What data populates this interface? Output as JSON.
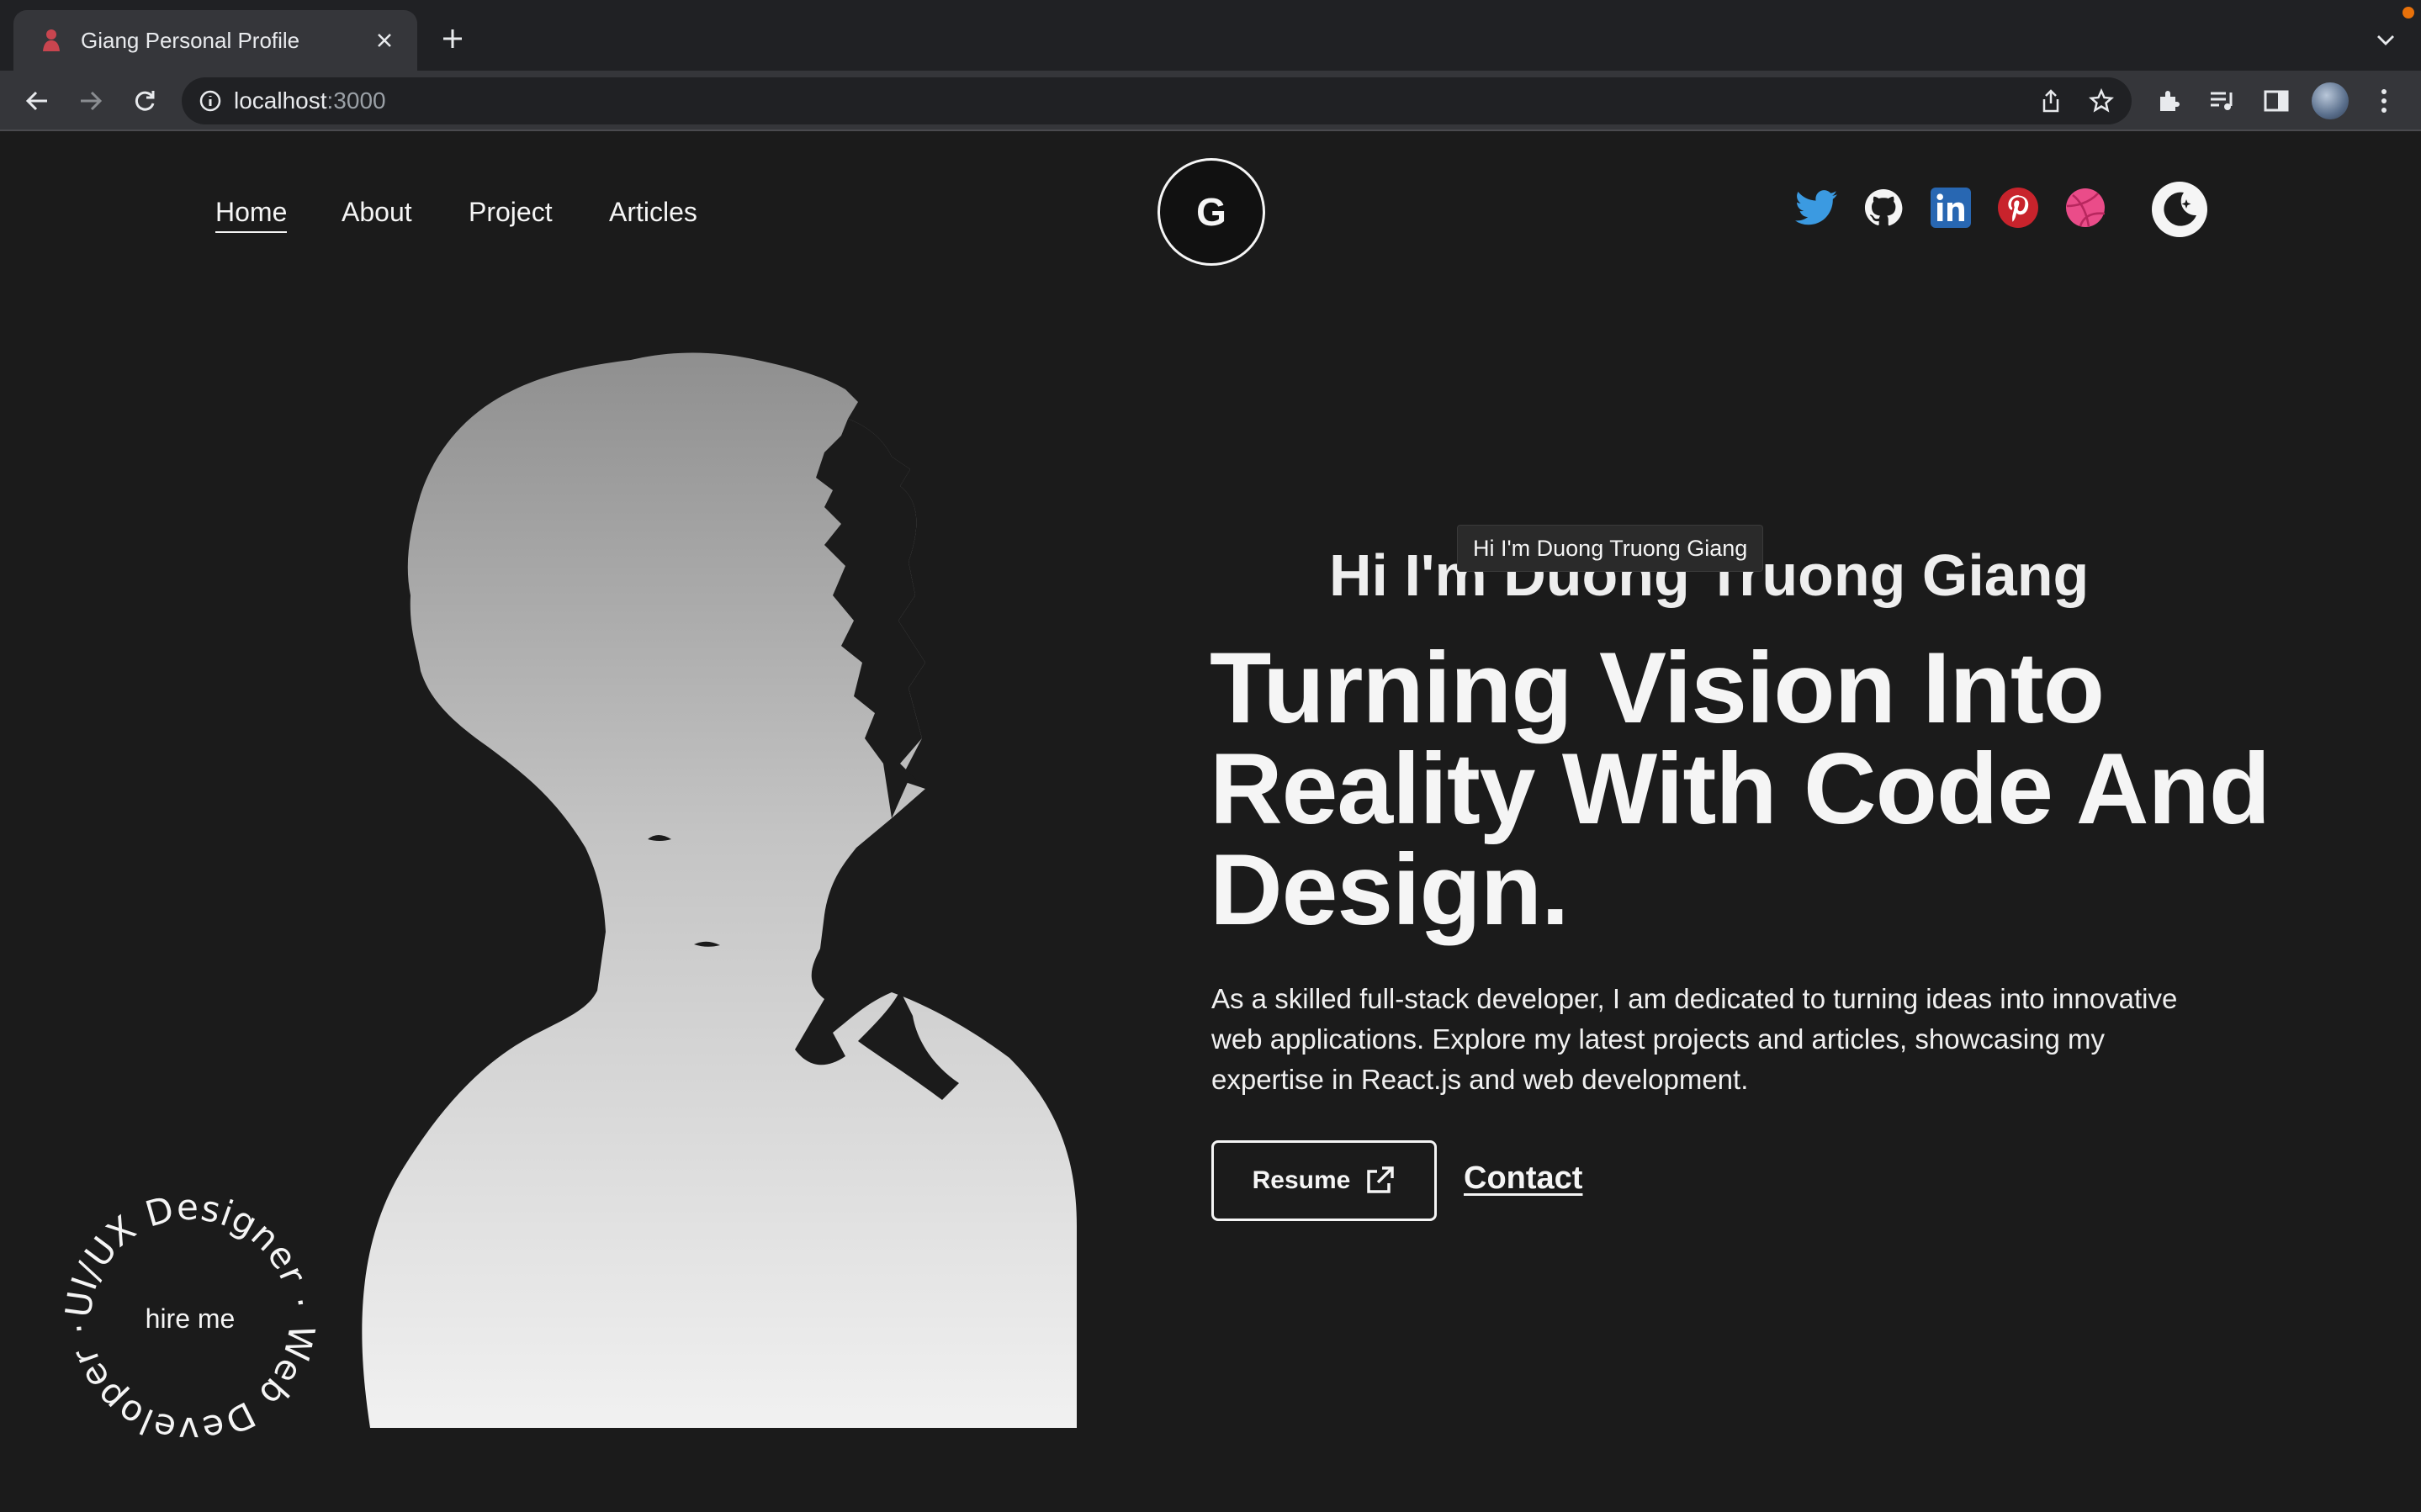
{
  "browser": {
    "tab_title": "Giang Personal Profile",
    "url_host": "localhost",
    "url_port": ":3000"
  },
  "nav": {
    "links": [
      "Home",
      "About",
      "Project",
      "Articles"
    ],
    "active": "Home",
    "logo": "G"
  },
  "social_icons": [
    "twitter-icon",
    "github-icon",
    "linkedin-icon",
    "pinterest-icon",
    "dribbble-icon"
  ],
  "colors": {
    "background": "#1b1b1b",
    "text": "#f5f5f5",
    "twitter": "#3b9ae1",
    "linkedin": "#2867b2",
    "pinterest": "#c8232c",
    "dribbble": "#ea4c89"
  },
  "hero": {
    "tooltip": "Hi I'm Duong Truong Giang",
    "greeting": "Hi I'm Duong Truong Giang",
    "headline": "Turning Vision Into Reality With Code And Design.",
    "intro": "As a skilled full-stack developer, I am dedicated to turning ideas into innovative web applications. Explore my latest projects and articles, showcasing my expertise in React.js and web development.",
    "resume_label": "Resume",
    "contact_label": "Contact"
  },
  "hire_badge": {
    "ring_text": "UI/UX Designer · Web Developer ·",
    "center_text": "hire me"
  }
}
